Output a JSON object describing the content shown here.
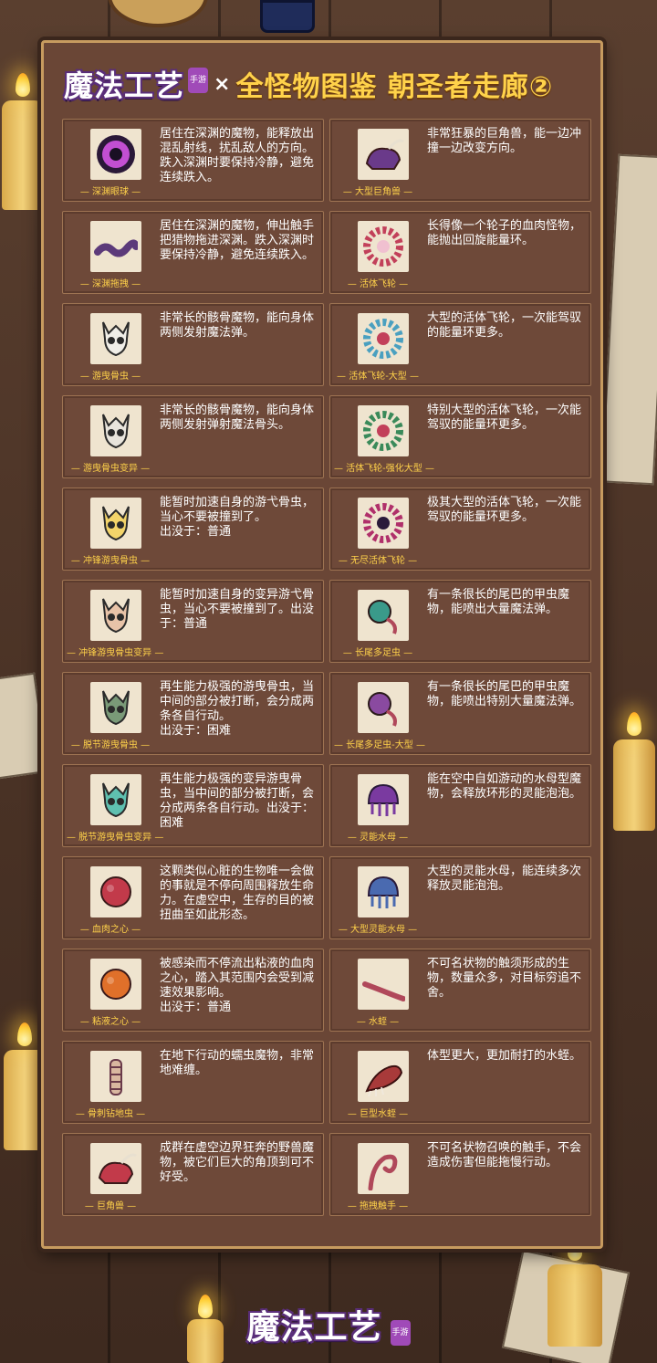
{
  "header": {
    "logo_text": "魔法工艺",
    "logo_tag": "手游",
    "cross": "×",
    "title": "全怪物图鉴  朝圣者走廊②"
  },
  "colors": {
    "panel": "#6a4636",
    "card": "#6e4939",
    "title_gold": "#ffd24a",
    "name_gold": "#ffd24a",
    "desc_text": "#ffffff"
  },
  "left": [
    {
      "name": "— 深渊眼球 —",
      "desc": "居住在深渊的魔物，能释放出混乱射线，扰乱敌人的方向。跌入深渊时要保持冷静，避免连续跌入。",
      "icon": "eyeball-icon"
    },
    {
      "name": "— 深渊拖拽 —",
      "desc": "居住在深渊的魔物，伸出触手把猎物拖进深渊。跌入深渊时要保持冷静，避免连续跌入。",
      "icon": "tentacle-icon"
    },
    {
      "name": "— 游曳骨虫 —",
      "desc": "非常长的骸骨魔物，能向身体两侧发射魔法弹。",
      "icon": "bone-skull-icon"
    },
    {
      "name": "— 游曳骨虫变异 —",
      "desc": "非常长的骸骨魔物，能向身体两侧发射弹射魔法骨头。",
      "icon": "bone-skull-mutant-icon"
    },
    {
      "name": "— 冲锋游曳骨虫 —",
      "desc": "能暂时加速自身的游弋骨虫，当心不要被撞到了。\n出没于：普通",
      "icon": "charge-skull-icon"
    },
    {
      "name": "— 冲锋游曳骨虫变异 —",
      "desc": "能暂时加速自身的变异游弋骨虫，当心不要被撞到了。出没于：普通",
      "icon": "charge-skull-mutant-icon"
    },
    {
      "name": "— 脱节游曳骨虫 —",
      "desc": "再生能力极强的游曳骨虫，当中间的部分被打断，会分成两条各自行动。\n出没于：困难",
      "icon": "split-skull-icon"
    },
    {
      "name": "— 脱节游曳骨虫变异 —",
      "desc": "再生能力极强的变异游曳骨虫，当中间的部分被打断，会分成两条各自行动。出没于：困难",
      "icon": "split-skull-mutant-icon"
    },
    {
      "name": "— 血肉之心 —",
      "desc": "这颗类似心脏的生物唯一会做的事就是不停向周围释放生命力。在虚空中，生存的目的被扭曲至如此形态。",
      "icon": "flesh-heart-icon"
    },
    {
      "name": "— 粘液之心 —",
      "desc": "被感染而不停流出粘液的血肉之心，踏入其范围内会受到减速效果影响。\n出没于：普通",
      "icon": "slime-heart-icon"
    },
    {
      "name": "— 骨刺钻地虫 —",
      "desc": "在地下行动的蠕虫魔物，非常地难缠。",
      "icon": "bone-worm-icon"
    },
    {
      "name": "— 巨角兽 —",
      "desc": "成群在虚空边界狂奔的野兽魔物，被它们巨大的角顶到可不好受。",
      "icon": "horned-beast-icon"
    }
  ],
  "right": [
    {
      "name": "— 大型巨角兽 —",
      "desc": "非常狂暴的巨角兽，能一边冲撞一边改变方向。",
      "icon": "large-horned-beast-icon"
    },
    {
      "name": "— 活体飞轮 —",
      "desc": "长得像一个轮子的血肉怪物，能抛出回旋能量环。",
      "icon": "flesh-wheel-icon"
    },
    {
      "name": "— 活体飞轮-大型 —",
      "desc": "大型的活体飞轮，一次能驾驭的能量环更多。",
      "icon": "flesh-wheel-large-icon"
    },
    {
      "name": "— 活体飞轮-强化大型 —",
      "desc": "特别大型的活体飞轮，一次能驾驭的能量环更多。",
      "icon": "flesh-wheel-enhanced-icon"
    },
    {
      "name": "— 无尽活体飞轮 —",
      "desc": "极其大型的活体飞轮，一次能驾驭的能量环更多。",
      "icon": "endless-wheel-icon"
    },
    {
      "name": "— 长尾多足虫 —",
      "desc": "有一条很长的尾巴的甲虫魔物，能喷出大量魔法弹。",
      "icon": "long-tail-bug-icon"
    },
    {
      "name": "— 长尾多足虫-大型 —",
      "desc": "有一条很长的尾巴的甲虫魔物，能喷出特别大量魔法弹。",
      "icon": "long-tail-bug-large-icon"
    },
    {
      "name": "— 灵能水母 —",
      "desc": "能在空中自如游动的水母型魔物，会释放环形的灵能泡泡。",
      "icon": "psi-jellyfish-icon"
    },
    {
      "name": "— 大型灵能水母 —",
      "desc": "大型的灵能水母，能连续多次释放灵能泡泡。",
      "icon": "large-psi-jellyfish-icon"
    },
    {
      "name": "— 水蛭 —",
      "desc": "不可名状物的触须形成的生物，数量众多，对目标穷追不舍。",
      "icon": "leech-icon"
    },
    {
      "name": "— 巨型水蛭 —",
      "desc": "体型更大，更加耐打的水蛭。",
      "icon": "giant-leech-icon"
    },
    {
      "name": "— 拖拽触手 —",
      "desc": "不可名状物召唤的触手，不会造成伤害但能拖慢行动。",
      "icon": "drag-tentacle-icon"
    }
  ],
  "footer": {
    "logo_text": "魔法工艺",
    "logo_tag": "手游"
  }
}
